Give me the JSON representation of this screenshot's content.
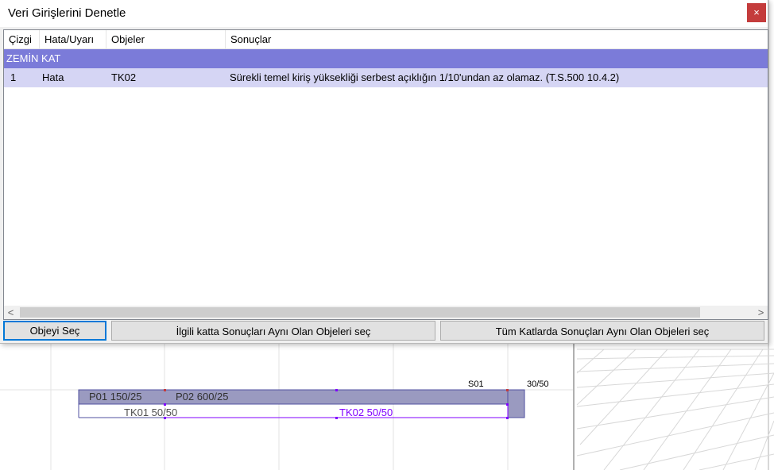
{
  "dialog": {
    "title": "Veri Girişlerini Denetle",
    "close_label": "×"
  },
  "table": {
    "columns": [
      "Çizgi",
      "Hata/Uyarı",
      "Objeler",
      "Sonuçlar"
    ],
    "group": "ZEMİN KAT",
    "rows": [
      {
        "line": "1",
        "type": "Hata",
        "object": "TK02",
        "result": "Sürekli temel kiriş yüksekliği serbest açıklığın 1/10'undan az olamaz. (T.S.500 10.4.2)"
      }
    ]
  },
  "buttons": {
    "select_object": "Objeyi Seç",
    "select_same_floor": "İlgili katta Sonuçları Aynı Olan Objeleri seç",
    "select_all_floors": "Tüm Katlarda Sonuçları Aynı Olan Objeleri seç"
  },
  "scroll": {
    "left_arrow": "<",
    "right_arrow": ">"
  },
  "canvas": {
    "labels": {
      "p01": "P01 150/25",
      "p02": "P02   600/25",
      "s01": "S01",
      "s01_size": "30/50",
      "tk01": "TK01 50/50",
      "tk02": "TK02 50/50"
    },
    "colors": {
      "beam_fill": "#9a9ac0",
      "beam_stroke": "#5050a0",
      "selected": "#8000ff",
      "grid": "#e0e0e0",
      "accent_red": "#c43c3c",
      "group_row": "#7b7bd9",
      "selected_row": "#d5d5f4"
    }
  }
}
